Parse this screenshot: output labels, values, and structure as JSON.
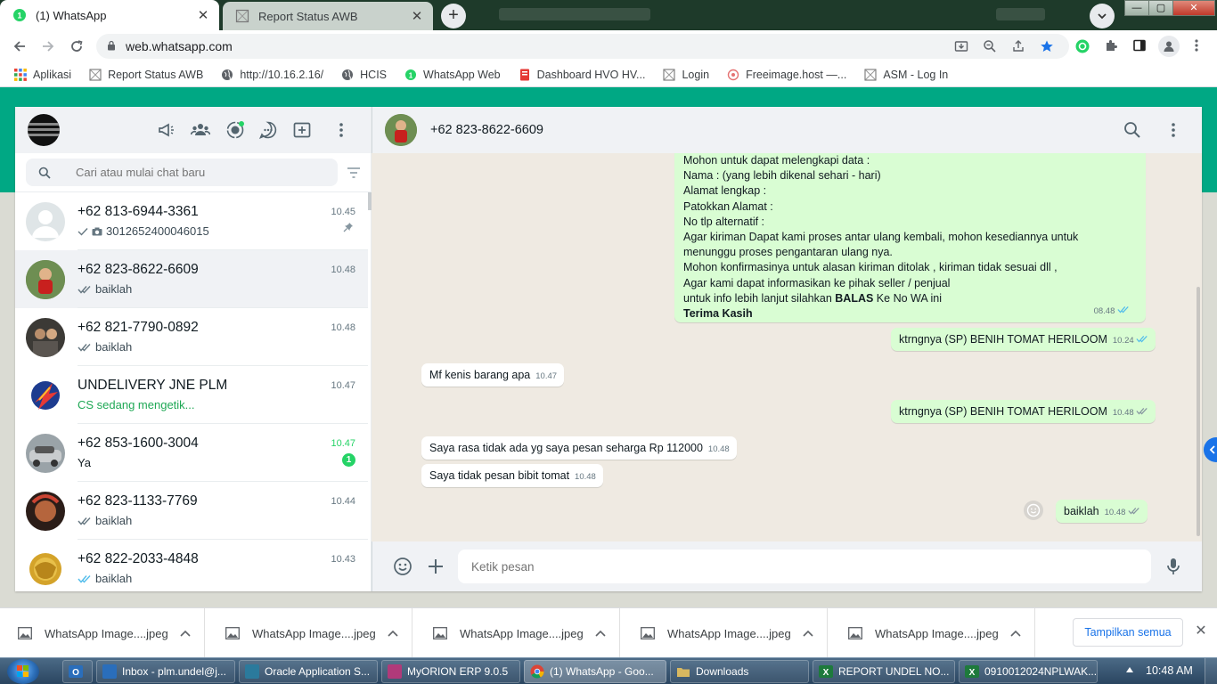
{
  "browser": {
    "tabs": [
      {
        "title": "(1) WhatsApp",
        "active": true
      },
      {
        "title": "Report Status AWB",
        "active": false
      }
    ],
    "new_tab_label": "+",
    "tab_close_label": "✕",
    "url": "web.whatsapp.com",
    "window_controls": {
      "minimize": "—",
      "maximize": "▢",
      "close": "✕"
    }
  },
  "bookmarks": [
    {
      "label": "Aplikasi",
      "icon": "apps-grid-icon"
    },
    {
      "label": "Report Status AWB",
      "icon": "page-icon"
    },
    {
      "label": "http://10.16.2.16/",
      "icon": "globe-icon"
    },
    {
      "label": "HCIS",
      "icon": "globe-icon"
    },
    {
      "label": "WhatsApp Web",
      "icon": "whatsapp-icon"
    },
    {
      "label": "Dashboard HVO HV...",
      "icon": "dashboard-icon"
    },
    {
      "label": "Login",
      "icon": "page-icon"
    },
    {
      "label": "Freeimage.host —...",
      "icon": "freeimage-icon"
    },
    {
      "label": "ASM - Log In",
      "icon": "page-icon"
    }
  ],
  "sidebar": {
    "search_placeholder": "Cari atau mulai chat baru",
    "chats": [
      {
        "name": "+62 813-6944-3361",
        "time": "10.45",
        "preview": "3012652400046015",
        "tick": "single",
        "photo": true,
        "pinned": true
      },
      {
        "name": "+62 823-8622-6609",
        "time": "10.48",
        "preview": "baiklah",
        "tick": "double",
        "selected": true
      },
      {
        "name": "+62 821-7790-0892",
        "time": "10.48",
        "preview": "baiklah",
        "tick": "double"
      },
      {
        "name": "UNDELIVERY JNE PLM",
        "time": "10.47",
        "preview": "CS sedang mengetik...",
        "typing": true
      },
      {
        "name": "+62 853-1600-3004",
        "time": "10.47",
        "preview": "Ya",
        "unread": "1"
      },
      {
        "name": "+62 823-1133-7769",
        "time": "10.44",
        "preview": "baiklah",
        "tick": "double"
      },
      {
        "name": "+62 822-2033-4848",
        "time": "10.43",
        "preview": "baiklah",
        "tick": "double-blue"
      }
    ]
  },
  "conversation": {
    "contact_name": "+62 823-8622-6609",
    "long_message": {
      "lines": [
        "Mohon untuk dapat melengkapi data :",
        "Nama : (yang lebih dikenal sehari - hari)",
        "Alamat  lengkap :",
        "Patokkan Alamat :",
        "No tlp alternatif :",
        "Agar kiriman Dapat kami proses antar ulang kembali, mohon kesediannya untuk",
        "menunggu proses pengantaran ulang nya.",
        "Mohon konfirmasinya untuk alasan kiriman ditolak , kiriman tidak sesuai dll ,",
        "Agar kami dapat informasikan ke pihak seller / penjual"
      ],
      "last_line_prefix": "untuk info lebih lanjut silahkan ",
      "last_line_bold": "BALAS",
      "last_line_suffix": " Ke No WA ini",
      "closing": "Terima Kasih",
      "time": "08.48"
    },
    "messages": [
      {
        "dir": "out",
        "text": "ktrngnya (SP) BENIH TOMAT HERILOOM",
        "time": "10.24",
        "tick": "blue"
      },
      {
        "dir": "in",
        "text": "Mf kenis barang apa",
        "time": "10.47"
      },
      {
        "dir": "out",
        "text": "ktrngnya (SP) BENIH TOMAT HERILOOM",
        "time": "10.48",
        "tick": "grey"
      },
      {
        "dir": "in",
        "text": "Saya rasa tidak ada yg saya pesan seharga Rp 112000",
        "time": "10.48"
      },
      {
        "dir": "in",
        "text": "Saya tidak pesan bibit tomat",
        "time": "10.48"
      },
      {
        "dir": "out",
        "text": "baiklah",
        "time": "10.48",
        "tick": "grey"
      }
    ],
    "composer_placeholder": "Ketik pesan"
  },
  "downloads": {
    "items": [
      "WhatsApp Image....jpeg",
      "WhatsApp Image....jpeg",
      "WhatsApp Image....jpeg",
      "WhatsApp Image....jpeg",
      "WhatsApp Image....jpeg"
    ],
    "show_all": "Tampilkan semua",
    "close_label": "✕"
  },
  "taskbar": {
    "items": [
      {
        "label": "Inbox - plm.undel@j...",
        "color": "#2a6ebb"
      },
      {
        "label": "Oracle Application S...",
        "color": "#2b7a9c"
      },
      {
        "label": "MyORION ERP 9.0.5",
        "color": "#b03a7a"
      },
      {
        "label": "(1) WhatsApp - Goo...",
        "color": "#e0a020",
        "active": true
      },
      {
        "label": "Downloads",
        "color": "#d8b860"
      },
      {
        "label": "REPORT UNDEL NO...",
        "color": "#1e7a3c"
      },
      {
        "label": "0910012024NPLWAK...",
        "color": "#1e7a3c"
      }
    ],
    "clock": "10:48 AM"
  },
  "colors": {
    "wa_green": "#00a884",
    "out_bubble": "#d9fdd3",
    "unread_green": "#25d366",
    "read_blue": "#53bdeb"
  }
}
